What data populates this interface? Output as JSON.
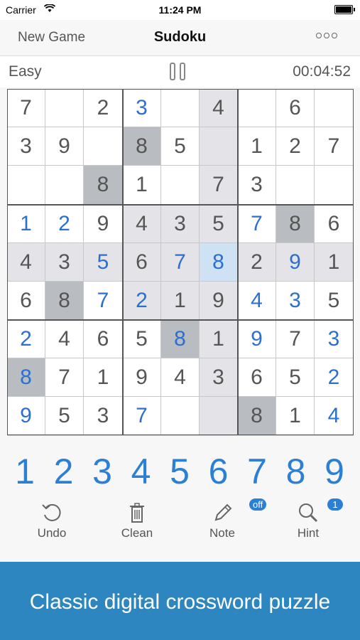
{
  "status_bar": {
    "carrier": "Carrier",
    "time": "11:24 PM"
  },
  "nav": {
    "left_button": "New Game",
    "title": "Sudoku",
    "more_icon": "more-icon"
  },
  "info": {
    "difficulty": "Easy",
    "timer": "00:04:52",
    "pause_icon": "pause-icon"
  },
  "board": {
    "cells": [
      [
        "7",
        "",
        "2",
        "3",
        "",
        "4",
        "",
        "6",
        ""
      ],
      [
        "3",
        "9",
        "",
        "8",
        "5",
        "",
        "1",
        "2",
        "7"
      ],
      [
        "",
        "",
        "8",
        "1",
        "",
        "7",
        "3",
        "",
        ""
      ],
      [
        "1",
        "2",
        "9",
        "4",
        "3",
        "5",
        "7",
        "8",
        "6"
      ],
      [
        "4",
        "3",
        "5",
        "6",
        "7",
        "8",
        "2",
        "9",
        "1"
      ],
      [
        "6",
        "8",
        "7",
        "2",
        "1",
        "9",
        "4",
        "3",
        "5"
      ],
      [
        "2",
        "4",
        "6",
        "5",
        "8",
        "1",
        "9",
        "7",
        "3"
      ],
      [
        "8",
        "7",
        "1",
        "9",
        "4",
        "3",
        "6",
        "5",
        "2"
      ],
      [
        "9",
        "5",
        "3",
        "7",
        "",
        "",
        "8",
        "1",
        "4"
      ]
    ],
    "user_entries": [
      [
        false,
        false,
        false,
        true,
        false,
        false,
        false,
        false,
        false
      ],
      [
        false,
        false,
        false,
        false,
        false,
        false,
        false,
        false,
        false
      ],
      [
        false,
        false,
        false,
        false,
        false,
        false,
        false,
        false,
        false
      ],
      [
        true,
        true,
        false,
        false,
        false,
        false,
        true,
        false,
        false
      ],
      [
        false,
        false,
        true,
        false,
        true,
        true,
        false,
        true,
        false
      ],
      [
        false,
        false,
        true,
        true,
        false,
        false,
        true,
        true,
        false
      ],
      [
        true,
        false,
        false,
        false,
        true,
        false,
        true,
        false,
        true
      ],
      [
        true,
        false,
        false,
        false,
        false,
        false,
        false,
        false,
        true
      ],
      [
        true,
        false,
        false,
        true,
        false,
        false,
        false,
        false,
        true
      ]
    ],
    "selected": {
      "row": 4,
      "col": 5
    },
    "highlight_value": "8",
    "colors": {
      "user": "#2b6fd1",
      "given": "#555555",
      "row_col_highlight": "#e4e4e8",
      "same_value": "#b9bcc0",
      "selected": "#cfe2f3"
    }
  },
  "numpad": [
    "1",
    "2",
    "3",
    "4",
    "5",
    "6",
    "7",
    "8",
    "9"
  ],
  "tools": [
    {
      "label": "Undo",
      "icon": "undo-icon"
    },
    {
      "label": "Clean",
      "icon": "trash-icon"
    },
    {
      "label": "Note",
      "icon": "pencil-icon",
      "badge": "off"
    },
    {
      "label": "Hint",
      "icon": "magnifier-icon",
      "badge": "1"
    }
  ],
  "banner": {
    "text": "Classic digital crossword puzzle"
  },
  "accent_color": "#2b7fd4",
  "banner_color": "#2e86c1"
}
